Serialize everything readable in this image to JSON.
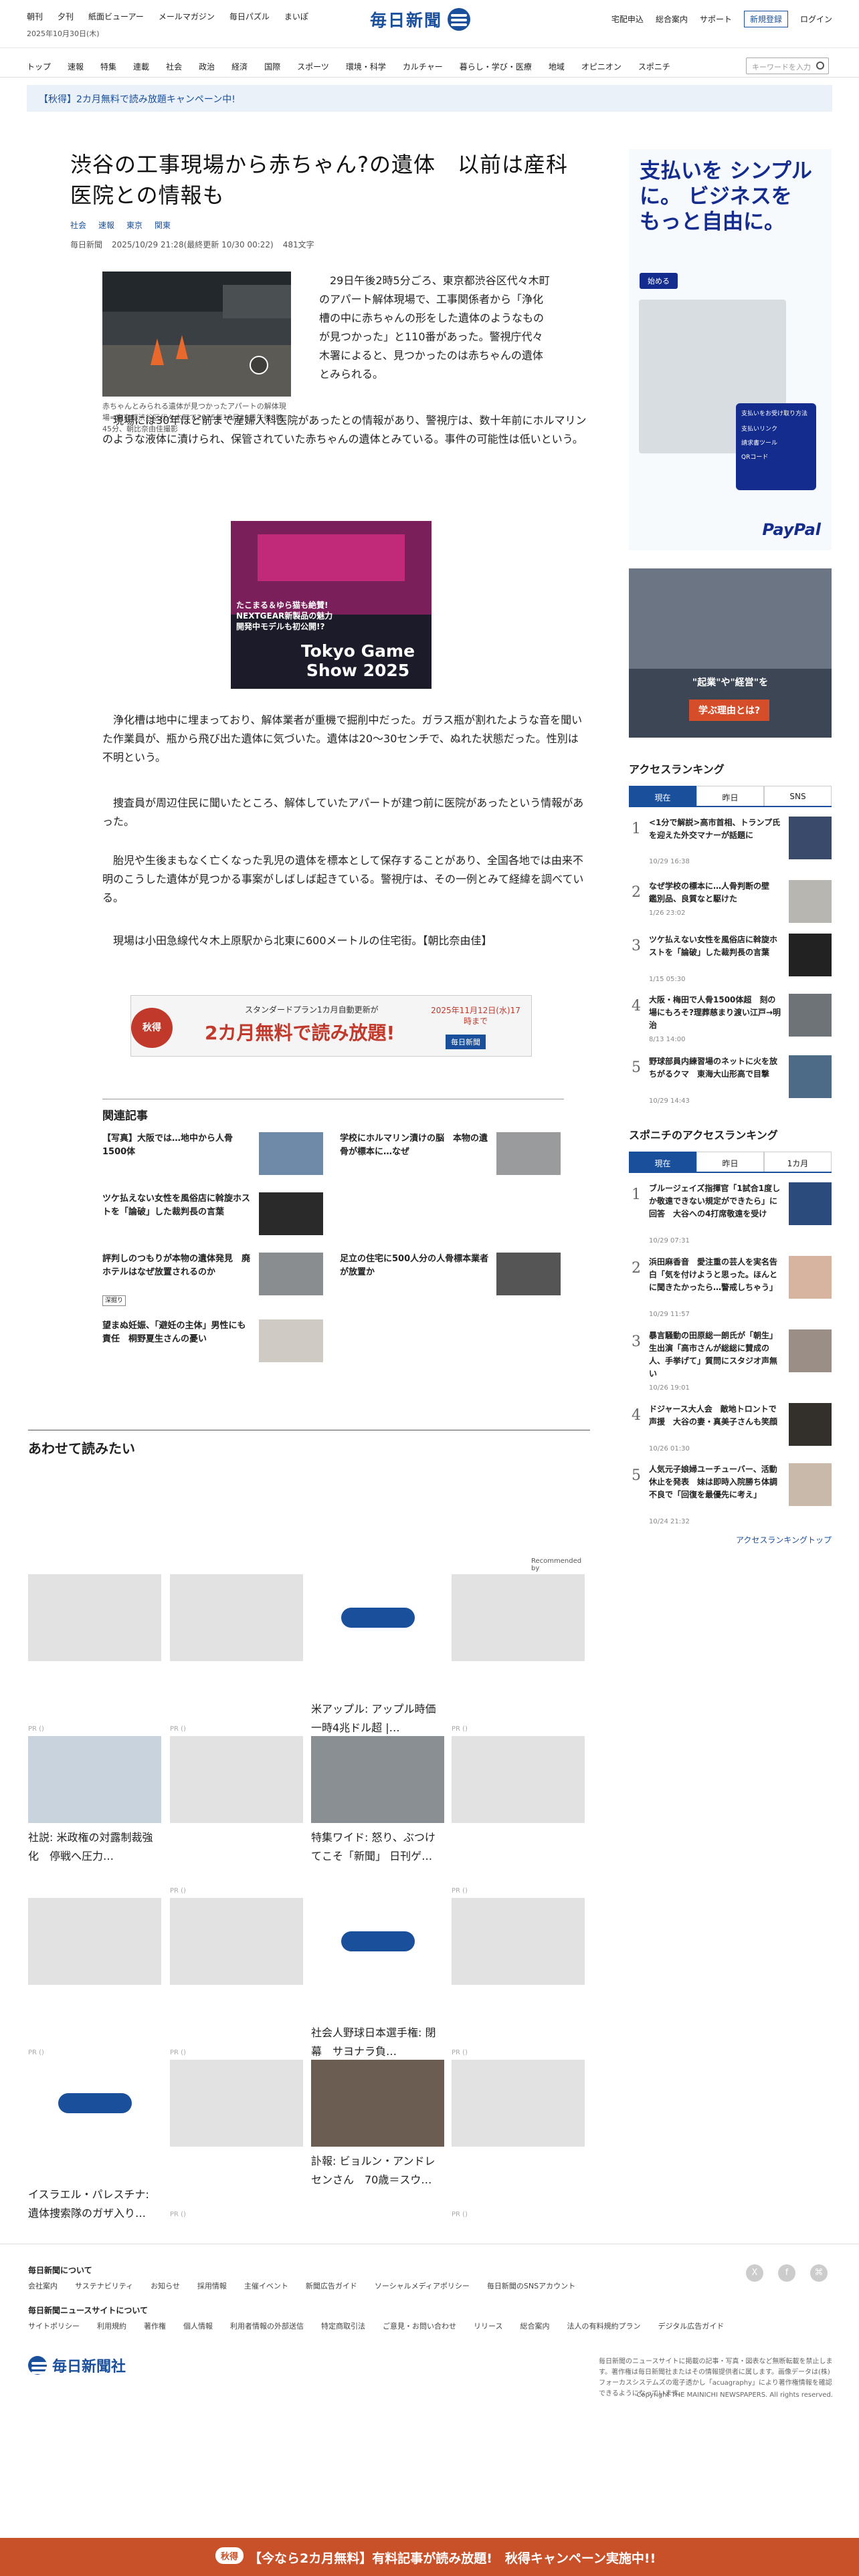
{
  "header": {
    "top_links": [
      "朝刊",
      "夕刊",
      "紙面ビューアー",
      "メールマガジン",
      "毎日パズル",
      "まいぽ"
    ],
    "date": "2025年10月30日(木)",
    "logo_text": "毎日新聞",
    "right_links": [
      "宅配申込",
      "総合案内",
      "サポート"
    ],
    "register_label": "新規登録",
    "login_label": "ログイン"
  },
  "nav": {
    "items": [
      "トップ",
      "速報",
      "特集",
      "連載",
      "社会",
      "政治",
      "経済",
      "国際",
      "スポーツ",
      "環境・科学",
      "カルチャー",
      "暮らし・学び・医療",
      "地域",
      "オピニオン",
      "スポニチ"
    ],
    "search_placeholder": "キーワードを入力"
  },
  "campaign_bar": "【秋得】2カ月無料で読み放題キャンペーン中!",
  "article": {
    "title": "渋谷の工事現場から赤ちゃん?の遺体　以前は産科医院との情報も",
    "tags": [
      "社会",
      "速報",
      "東京",
      "関東"
    ],
    "source": "毎日新聞",
    "datetime": "2025/10/29 21:28(最終更新 10/30 00:22)",
    "chars": "481文字",
    "photo_caption": "赤ちゃんとみられる遺体が見つかったアパートの解体現場=東京都渋谷区代々木町で2025年10月29日午後8時45分、朝比奈由佳撮影",
    "paragraphs": [
      "29日午後2時5分ごろ、東京都渋谷区代々木町のアパート解体現場で、工事関係者から「浄化槽の中に赤ちゃんの形をした遺体のようなものが見つかった」と110番があった。警視庁代々木署によると、見つかったのは赤ちゃんの遺体とみられる。",
      "現場には30年ほど前まで産婦人科医院があったとの情報があり、警視庁は、数十年前にホルマリンのような液体に漬けられ、保管されていた赤ちゃんの遺体とみている。事件の可能性は低いという。",
      "浄化槽は地中に埋まっており、解体業者が重機で掘削中だった。ガラス瓶が割れたような音を聞いた作業員が、瓶から飛び出た遺体に気づいた。遺体は20～30センチで、ぬれた状態だった。性別は不明という。",
      "捜査員が周辺住民に聞いたところ、解体していたアパートが建つ前に医院があったという情報があった。",
      "胎児や生後まもなく亡くなった乳児の遺体を標本として保存することがあり、全国各地では由来不明のこうした遺体が見つかる事案がしばしば起きている。警視庁は、その一例とみて経緯を調べている。",
      "現場は小田急線代々木上原駅から北東に600メートルの住宅街。【朝比奈由佳】"
    ],
    "game_ad": {
      "line1": "たこまる＆ゆら猫も絶賛!",
      "line2": "NEXTGEAR新製品の魅力",
      "line3": "開発中モデルも初公開!?",
      "title": "Tokyo Game Show 2025"
    },
    "banner": {
      "badge": "秋得",
      "lead": "スタンダードプラン1カ月自動更新が",
      "main": "2カ月無料で読み放題!",
      "date": "2025年11月12日(水)17時まで",
      "brand": "毎日新聞"
    }
  },
  "related": {
    "heading": "関連記事",
    "items": [
      {
        "title": "【写真】大阪では…地中から人骨1500体"
      },
      {
        "title": "学校にホルマリン漬けの脳　本物の遺骨が標本に…なぜ"
      },
      {
        "title": "ツケ払えない女性を風俗店に斡旋ホストを「論破」した裁判長の言葉"
      },
      {
        "title": "評判しのつもりが本物の遺体発見　廃ホテルはなぜ放置されるのか",
        "badge": "深掘り"
      },
      {
        "title": "足立の住宅に500人分の人骨標本業者が放置か"
      },
      {
        "title": "望まぬ妊娠、「避妊の主体」男性にも責任　桐野夏生さんの憂い"
      }
    ]
  },
  "sidebar": {
    "paypal": {
      "headline": "支払いを シンプルに。 ビジネスを もっと自由に。",
      "cta": "始める",
      "brand": "PayPal",
      "card_title": "支払いをお受け取り方法",
      "opts": [
        "支払いリンク",
        "請求書ツール",
        "QRコード"
      ]
    },
    "ad2": {
      "text1": "\"起業\"や\"経営\"を",
      "text2": "学ぶ理由とは?"
    },
    "ranking": {
      "heading": "アクセスランキング",
      "tabs": [
        "現在",
        "昨日",
        "SNS"
      ],
      "items": [
        {
          "num": "1",
          "title": "<1分で解説>高市首相、トランプ氏を迎えた外交マナーが話題に",
          "date": "10/29 16:38"
        },
        {
          "num": "2",
          "title": "なぜ学校の標本に…人骨判断の壁　鑑別品、良質なと駆けた",
          "date": "1/26 23:02"
        },
        {
          "num": "3",
          "title": "ツケ払えない女性を風俗店に斡旋ホストを「論破」した裁判長の言葉",
          "date": "1/15 05:30"
        },
        {
          "num": "4",
          "title": "大阪・梅田で人骨1500体超　刻の場にもろそ?理葬慈まり渡い江戸→明治",
          "date": "8/13 14:00"
        },
        {
          "num": "5",
          "title": "野球部員内練習場のネットに火を放ちがるクマ　東海大山形高で目撃",
          "date": "10/29 14:43"
        }
      ]
    },
    "sponichi": {
      "heading": "スポニチのアクセスランキング",
      "tabs": [
        "現在",
        "昨日",
        "1カ月"
      ],
      "items": [
        {
          "num": "1",
          "title": "ブルージェイズ指揮官「1試合1度しか敬遠できない規定ができたら」に回答　大谷への4打席敬遠を受け",
          "date": "10/29 07:31"
        },
        {
          "num": "2",
          "title": "浜田麻香音　愛注重の芸人を実名告白「気を付けようと思った。ほんとに聞きたかったら…警戒しちゃう」",
          "date": "10/29 11:57"
        },
        {
          "num": "3",
          "title": "暴言騒動の田原総一朗氏が「朝生」生出演「高市さんが総総に賛成の人、手挙げて」質問にスタジオ声無い",
          "date": "10/26 19:01"
        },
        {
          "num": "4",
          "title": "ドジャース大人会　敵地トロントで声援　大谷の妻・真美子さんも笑顔",
          "date": "10/26 01:30"
        },
        {
          "num": "5",
          "title": "人気元子娘婦ユーチューバー、活動休止を発表　妹は即時入院勝ち体調不良で「回復を最優先に考え」",
          "date": "10/24 21:32"
        }
      ],
      "more": "アクセスランキングトップ"
    }
  },
  "recommend": {
    "heading": "あわせて読みたい",
    "by": "Recommended by",
    "cards": [
      {
        "title": "",
        "pr": "PR ()"
      },
      {
        "title": "",
        "pr": "PR ()"
      },
      {
        "title": "米アップル: アップル時価　一時4兆ドル超 |…",
        "pr": ""
      },
      {
        "title": "",
        "pr": "PR ()"
      },
      {
        "title": "社説: 米政権の対露制裁強化　停戦へ圧力…",
        "pr": ""
      },
      {
        "title": "",
        "pr": "PR ()"
      },
      {
        "title": "特集ワイド: 怒り、ぶつけてこそ「新聞」 日刊ゲ…",
        "pr": ""
      },
      {
        "title": "",
        "pr": "PR ()"
      },
      {
        "title": "",
        "pr": "PR ()"
      },
      {
        "title": "",
        "pr": "PR ()"
      },
      {
        "title": "社会人野球日本選手権: 閉幕　サヨナラ負…",
        "pr": ""
      },
      {
        "title": "",
        "pr": "PR ()"
      },
      {
        "title": "イスラエル・パレスチナ: 遺体捜索隊のガザ入り…",
        "pr": ""
      },
      {
        "title": "",
        "pr": "PR ()"
      },
      {
        "title": "訃報: ビョルン・アンドレセンさん　70歳＝スウ…",
        "pr": ""
      },
      {
        "title": "",
        "pr": "PR ()"
      }
    ]
  },
  "footer": {
    "about_heading": "毎日新聞について",
    "about_links": [
      "会社案内",
      "サステナビリティ",
      "お知らせ",
      "採用情報",
      "主催イベント",
      "新聞広告ガイド",
      "ソーシャルメディアポリシー",
      "毎日新聞のSNSアカウント"
    ],
    "site_heading": "毎日新聞ニュースサイトについて",
    "site_links": [
      "サイトポリシー",
      "利用規約",
      "著作権",
      "個人情報",
      "利用者情報の外部送信",
      "特定商取引法",
      "ご意見・お問い合わせ",
      "リリース",
      "総合案内",
      "法人の有料規約プラン",
      "デジタル広告ガイド"
    ],
    "company": "毎日新聞社",
    "notice": "毎日新聞のニュースサイトに掲載の記事・写真・図表など無断転載を禁止します。著作権は毎日新聞社またはその情報提供者に属します。画像データは(株)フォーカスシステムズの電子透かし「acuagraphy」により著作権情報を確認できるようになっています。",
    "copyright": "Copyright THE MAINICHI NEWSPAPERS. All rights reserved.",
    "social": [
      "X",
      "f",
      "⌘"
    ]
  },
  "bottom_bar": {
    "badge": "秋得",
    "text": "【今なら2カ月無料】有料記事が読み放題!　秋得キャンペーン実施中!!"
  }
}
